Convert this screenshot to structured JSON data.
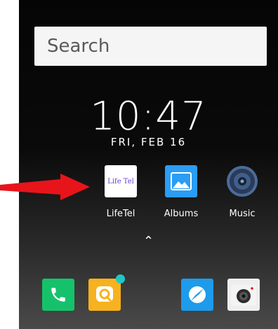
{
  "search": {
    "placeholder": "Search"
  },
  "clock": {
    "time": "10:47",
    "date": "FRI, FEB 16"
  },
  "apps": [
    {
      "label": "LifeTel",
      "icon": "lifetel-icon",
      "icon_text": "Life Tel"
    },
    {
      "label": "Albums",
      "icon": "albums-icon"
    },
    {
      "label": "Music",
      "icon": "music-icon"
    }
  ],
  "drawer": {
    "icon": "chevron-up-icon",
    "glyph": "⌃"
  },
  "dock": [
    {
      "icon": "phone-icon"
    },
    {
      "icon": "chat-icon",
      "badge": true
    },
    {
      "icon": "browser-icon"
    },
    {
      "icon": "camera-icon"
    }
  ],
  "colors": {
    "annotation_arrow": "#e8141b",
    "albums": "#2a9df4",
    "phone": "#15c26b",
    "chat": "#f7b21f",
    "browser": "#1e9bea",
    "badge": "#1ec9c4"
  }
}
